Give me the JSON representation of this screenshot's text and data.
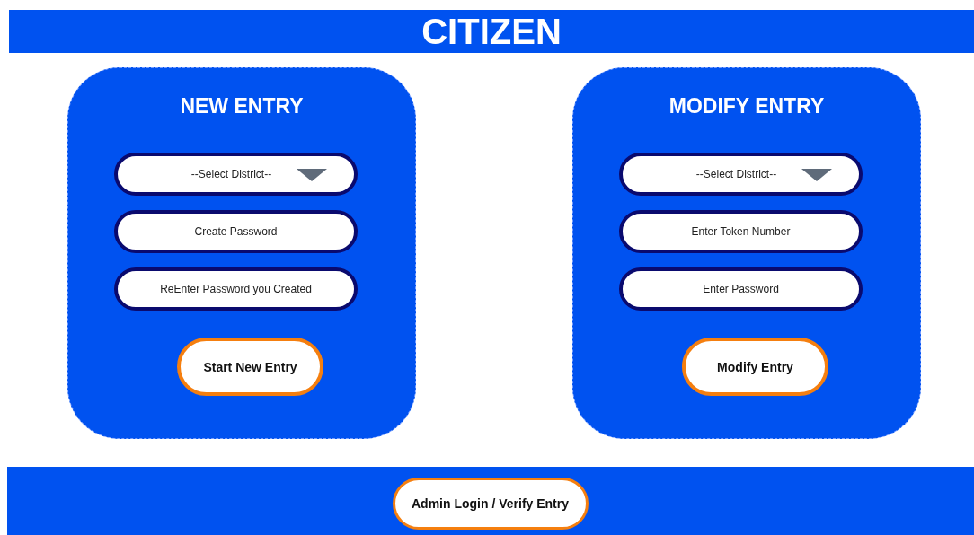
{
  "header": {
    "title": "CITIZEN"
  },
  "panels": [
    {
      "title": "NEW ENTRY",
      "fields": [
        {
          "kind": "select",
          "placeholder": "--Select District--"
        },
        {
          "kind": "text",
          "placeholder": "Create Password"
        },
        {
          "kind": "text",
          "placeholder": "ReEnter Password you Created"
        }
      ],
      "button": "Start New Entry"
    },
    {
      "title": "MODIFY ENTRY",
      "fields": [
        {
          "kind": "select",
          "placeholder": "--Select District--"
        },
        {
          "kind": "text",
          "placeholder": "Enter Token Number"
        },
        {
          "kind": "text",
          "placeholder": "Enter Password"
        }
      ],
      "button": "Modify Entry"
    }
  ],
  "footer": {
    "button": "Admin Login / Verify Entry"
  }
}
